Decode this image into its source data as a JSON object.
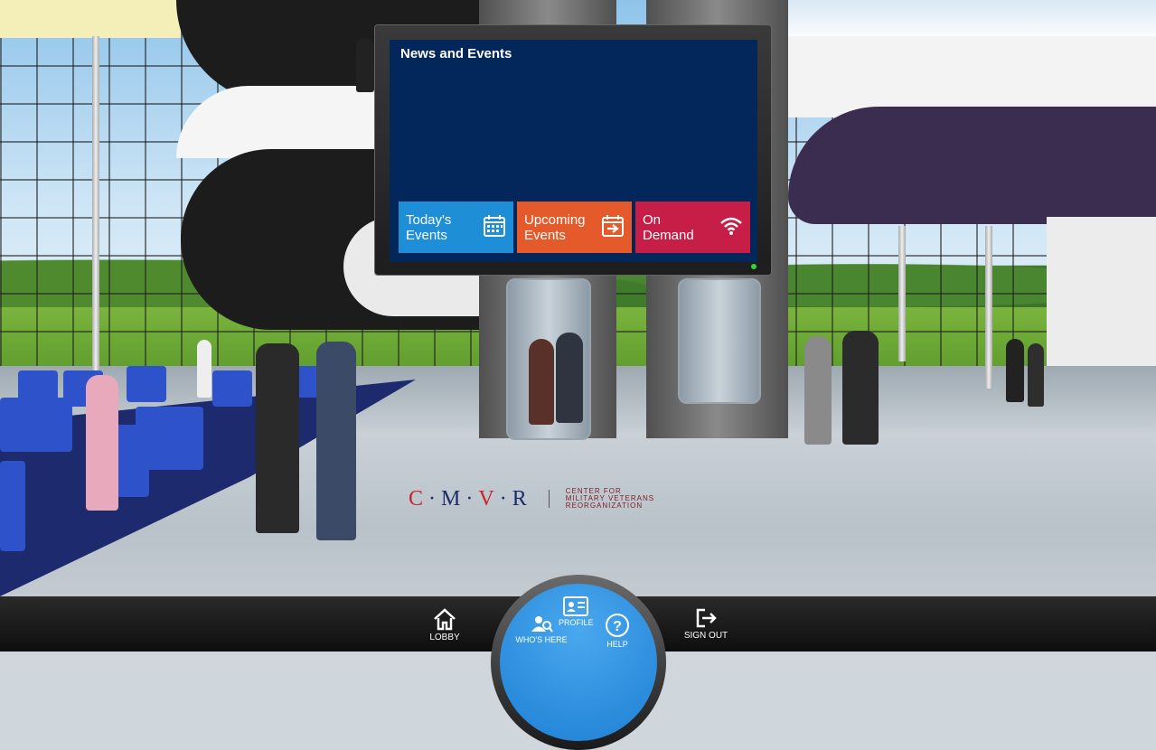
{
  "news_panel": {
    "title": "News and Events",
    "tiles": [
      {
        "line1": "Today's",
        "line2": "Events",
        "icon": "calendar-icon",
        "color": "#1e8fd6"
      },
      {
        "line1": "Upcoming",
        "line2": "Events",
        "icon": "calendar-arrow-icon",
        "color": "#e55a2b"
      },
      {
        "line1": "On",
        "line2": "Demand",
        "icon": "wifi-icon",
        "color": "#c61e47"
      }
    ]
  },
  "floor_logo": {
    "mark_parts": [
      "C",
      "M",
      "V",
      "R"
    ],
    "line1": "CENTER FOR",
    "line2": "MILITARY VETERANS",
    "line3": "REORGANIZATION"
  },
  "bottom_nav": {
    "lobby": "LOBBY",
    "profile": "PROFILE",
    "whos_here": "WHO'S HERE",
    "help": "HELP",
    "sign_out": "SIGN OUT"
  }
}
